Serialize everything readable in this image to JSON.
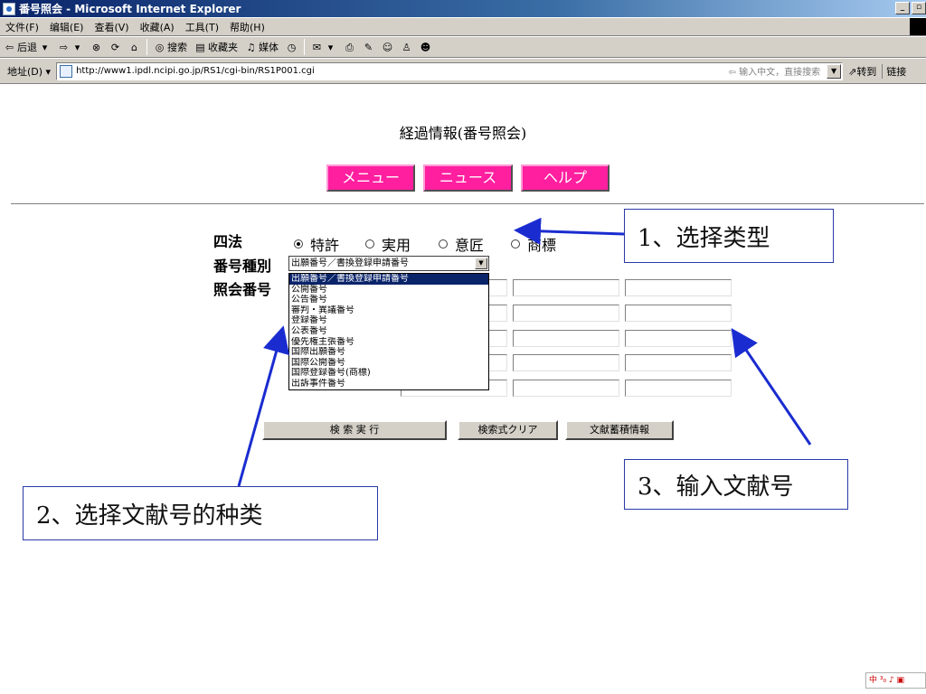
{
  "window": {
    "title": "番号照会 - Microsoft Internet Explorer",
    "controls": [
      "_",
      "▫"
    ]
  },
  "menu": [
    "文件(F)",
    "编辑(E)",
    "查看(V)",
    "收藏(A)",
    "工具(T)",
    "帮助(H)"
  ],
  "toolbar": {
    "back": "后退",
    "search": "搜索",
    "favorites": "收藏夹",
    "media": "媒体"
  },
  "address": {
    "label": "地址(D)",
    "url": "http://www1.ipdl.ncipi.go.jp/RS1/cgi-bin/RS1P001.cgi",
    "hint": "输入中文，直接搜索",
    "go": "转到",
    "links": "链接"
  },
  "page": {
    "title": "経過情報(番号照会)",
    "nav": [
      "メニュー",
      "ニュース",
      "ヘルプ"
    ],
    "law_label": "四法",
    "law_options": [
      {
        "label": "特許",
        "checked": true
      },
      {
        "label": "実用",
        "checked": false
      },
      {
        "label": "意匠",
        "checked": false
      },
      {
        "label": "商標",
        "checked": false
      }
    ],
    "type_label": "番号種別",
    "type_selected": "出願番号／書換登録申請番号",
    "type_options": [
      "出願番号／書換登録申請番号",
      "公開番号",
      "公告番号",
      "審判・異議番号",
      "登録番号",
      "公表番号",
      "優先権主張番号",
      "国際出願番号",
      "国際公開番号",
      "国際登録番号(商標)",
      "出訴事件番号"
    ],
    "query_label": "照会番号",
    "buttons": [
      "検 索 実 行",
      "検索式クリア",
      "文献蓄積情報"
    ]
  },
  "callouts": {
    "step1": "1、选择类型",
    "step2": "2、选择文献号的种类",
    "step3": "3、输入文献号"
  },
  "colors": {
    "nav_button": "#ff1f9f",
    "arrow": "#1a2cd0",
    "selection": "#0a246a"
  },
  "tray": "中 ³₀ ♪ ▣"
}
